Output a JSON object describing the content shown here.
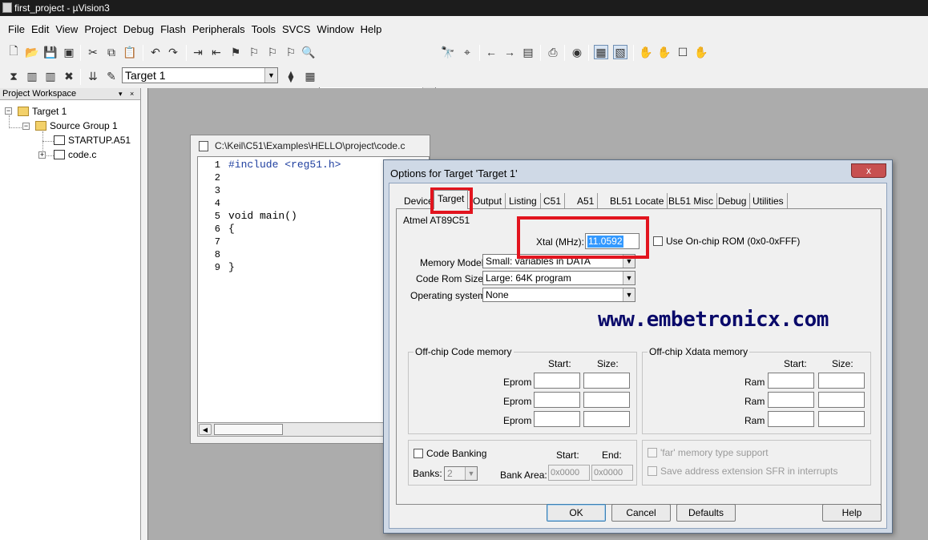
{
  "window": {
    "title": "first_project - µVision3"
  },
  "menu": [
    "File",
    "Edit",
    "View",
    "Project",
    "Debug",
    "Flash",
    "Peripherals",
    "Tools",
    "SVCS",
    "Window",
    "Help"
  ],
  "toolbar": {
    "find_value": "",
    "target_select": "Target 1"
  },
  "workspace": {
    "title": "Project Workspace",
    "tree": {
      "target": "Target 1",
      "group": "Source Group 1",
      "files": [
        "STARTUP.A51",
        "code.c"
      ]
    }
  },
  "editor": {
    "title": "C:\\Keil\\C51\\Examples\\HELLO\\project\\code.c",
    "lines": [
      {
        "num": "1",
        "text": "#include <reg51.h>"
      },
      {
        "num": "2",
        "text": ""
      },
      {
        "num": "3",
        "text": ""
      },
      {
        "num": "4",
        "text": ""
      },
      {
        "num": "5",
        "text": "void main()"
      },
      {
        "num": "6",
        "text": "{"
      },
      {
        "num": "7",
        "text": ""
      },
      {
        "num": "8",
        "text": ""
      },
      {
        "num": "9",
        "text": "}"
      }
    ]
  },
  "dialog": {
    "title": "Options for Target 'Target 1'",
    "close": "x",
    "tabs": [
      "Device",
      "Target",
      "Output",
      "Listing",
      "C51",
      "A51",
      "BL51 Locate",
      "BL51 Misc",
      "Debug",
      "Utilities"
    ],
    "active_tab": "Target",
    "device": "Atmel AT89C51",
    "xtal_label": "Xtal (MHz):",
    "xtal_value": "11.0592",
    "onchip_rom_label": "Use On-chip ROM (0x0-0xFFF)",
    "memory_model_label": "Memory Model:",
    "memory_model_value": "Small: variables in DATA",
    "code_rom_label": "Code Rom Size:",
    "code_rom_value": "Large: 64K program",
    "os_label": "Operating system:",
    "os_value": "None",
    "offchip_code": {
      "title": "Off-chip Code memory",
      "start": "Start:",
      "size": "Size:",
      "rows": [
        "Eprom",
        "Eprom",
        "Eprom"
      ]
    },
    "offchip_xdata": {
      "title": "Off-chip Xdata memory",
      "start": "Start:",
      "size": "Size:",
      "rows": [
        "Ram",
        "Ram",
        "Ram"
      ]
    },
    "code_banking": {
      "label": "Code Banking",
      "start": "Start:",
      "end": "End:",
      "banks_label": "Banks:",
      "banks_value": "2",
      "bank_area_label": "Bank Area:",
      "bank_start": "0x0000",
      "bank_end": "0x0000"
    },
    "far_memory": "'far' memory type support",
    "save_sfr": "Save address extension SFR in interrupts",
    "buttons": {
      "ok": "OK",
      "cancel": "Cancel",
      "defaults": "Defaults",
      "help": "Help"
    }
  },
  "watermark": "www.embetronicx.com",
  "colors": {
    "highlight": "#e2141e",
    "watermark": "#0a0a6a"
  }
}
